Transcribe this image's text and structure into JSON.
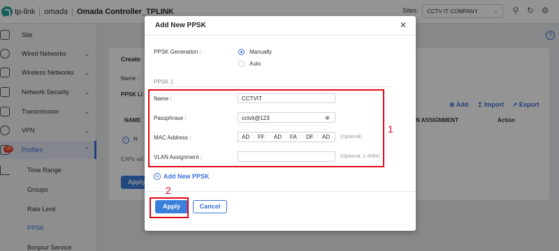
{
  "header": {
    "logo_text": "tp-link",
    "brand": "omada",
    "controller_title": "Omada Controller_TPLINK",
    "sites_label": "Sites:",
    "site_selected": "CCTV IT COMPANY"
  },
  "sidebar": {
    "items": [
      {
        "label": "Site"
      },
      {
        "label": "Wired Networks"
      },
      {
        "label": "Wireless Networks"
      },
      {
        "label": "Network Security"
      },
      {
        "label": "Transmission"
      },
      {
        "label": "VPN"
      },
      {
        "label": "Profiles"
      }
    ],
    "badge": "10",
    "sub_items": [
      "Time Range",
      "Groups",
      "Rate Limit",
      "PPSK",
      "Bonjour Service"
    ]
  },
  "background": {
    "create_text": "Create",
    "name_label": "Name :",
    "ppsk_list": "PPSK Li",
    "name_col": "NAME",
    "eaps_text": "EAPs wit",
    "apply_bg": "Apply",
    "info_n": "N",
    "add": "Add",
    "import": "Import",
    "export": "Export",
    "assignment_col": "N ASSIGNMENT",
    "action_col": "Action"
  },
  "modal": {
    "title": "Add New PPSK",
    "ppsk_generation_label": "PPSK Generation :",
    "radio_manually": "Manually",
    "radio_auto": "Auto",
    "section_title": "PPSK 1",
    "name_label": "Name :",
    "name_value": "CCTVIT",
    "passphrase_label": "Passphrase :",
    "passphrase_value": "cctvit@123",
    "mac_label": "MAC Address :",
    "mac_segments": [
      "AD",
      "FF",
      "AD",
      "FA",
      "DF",
      "AD"
    ],
    "mac_hint": "(Optional)",
    "vlan_label": "VLAN Assignment :",
    "vlan_hint": "(Optional, 1-4094)",
    "add_new": "Add New PPSK",
    "apply": "Apply",
    "cancel": "Cancel"
  },
  "annotations": {
    "one": "1",
    "two": "2"
  },
  "colors": {
    "accent": "#3a6fd8",
    "annotation": "#e30613",
    "badge": "#e8412c"
  }
}
